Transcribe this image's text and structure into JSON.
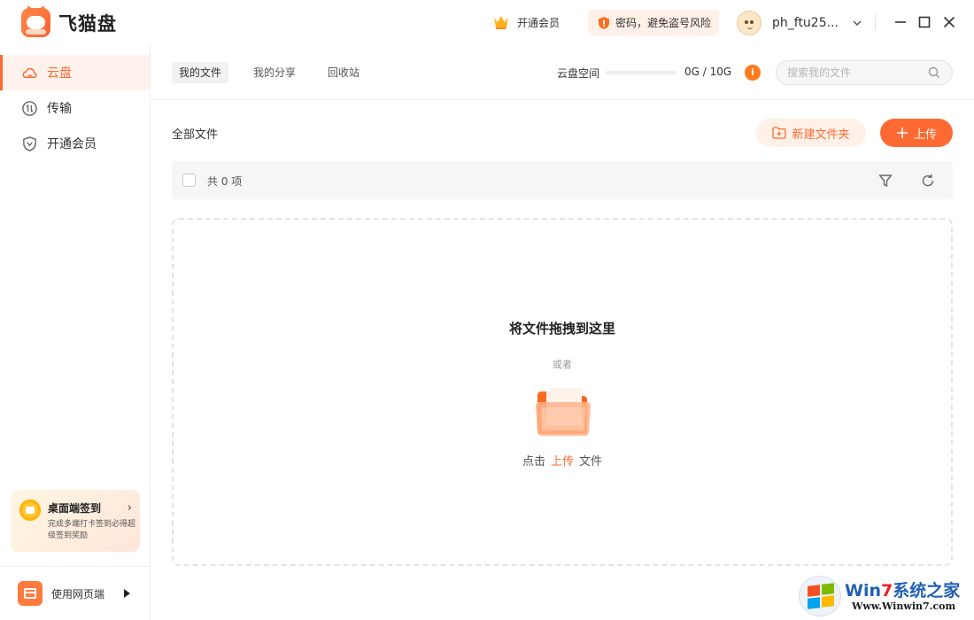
{
  "app": {
    "name": "飞猫盘"
  },
  "header": {
    "vip_label": "开通会员",
    "security_tip": "密码，避免盗号风险",
    "username": "ph_ftu25..."
  },
  "sidebar": {
    "items": [
      {
        "label": "云盘",
        "icon": "cloud-icon",
        "active": true
      },
      {
        "label": "传输",
        "icon": "transfer-icon",
        "active": false
      },
      {
        "label": "开通会员",
        "icon": "vip-shield-icon",
        "active": false
      }
    ],
    "checkin": {
      "title": "桌面端签到",
      "desc": "完成多端打卡签到必得超级签到奖励"
    },
    "web_entry": "使用网页端"
  },
  "tabs": [
    {
      "label": "我的文件",
      "active": true
    },
    {
      "label": "我的分享",
      "active": false
    },
    {
      "label": "回收站",
      "active": false
    }
  ],
  "storage": {
    "label": "云盘空间",
    "value": "0G / 10G",
    "used_fraction": 0
  },
  "search": {
    "placeholder": "搜索我的文件"
  },
  "main": {
    "section_title": "全部文件",
    "new_folder_label": "新建文件夹",
    "upload_label": "上传",
    "item_count": "共 0 项"
  },
  "dropzone": {
    "title": "将文件拖拽到这里",
    "or": "或者",
    "hint_prefix": "点击",
    "hint_link": "上传",
    "hint_suffix": "文件"
  },
  "watermark": {
    "title_part1": "Win",
    "title_part2": "7",
    "title_part3": "系统之家",
    "url": "Www.Winwin7.com"
  },
  "colors": {
    "accent": "#ff6a33",
    "accent_light": "#fff1e8"
  }
}
